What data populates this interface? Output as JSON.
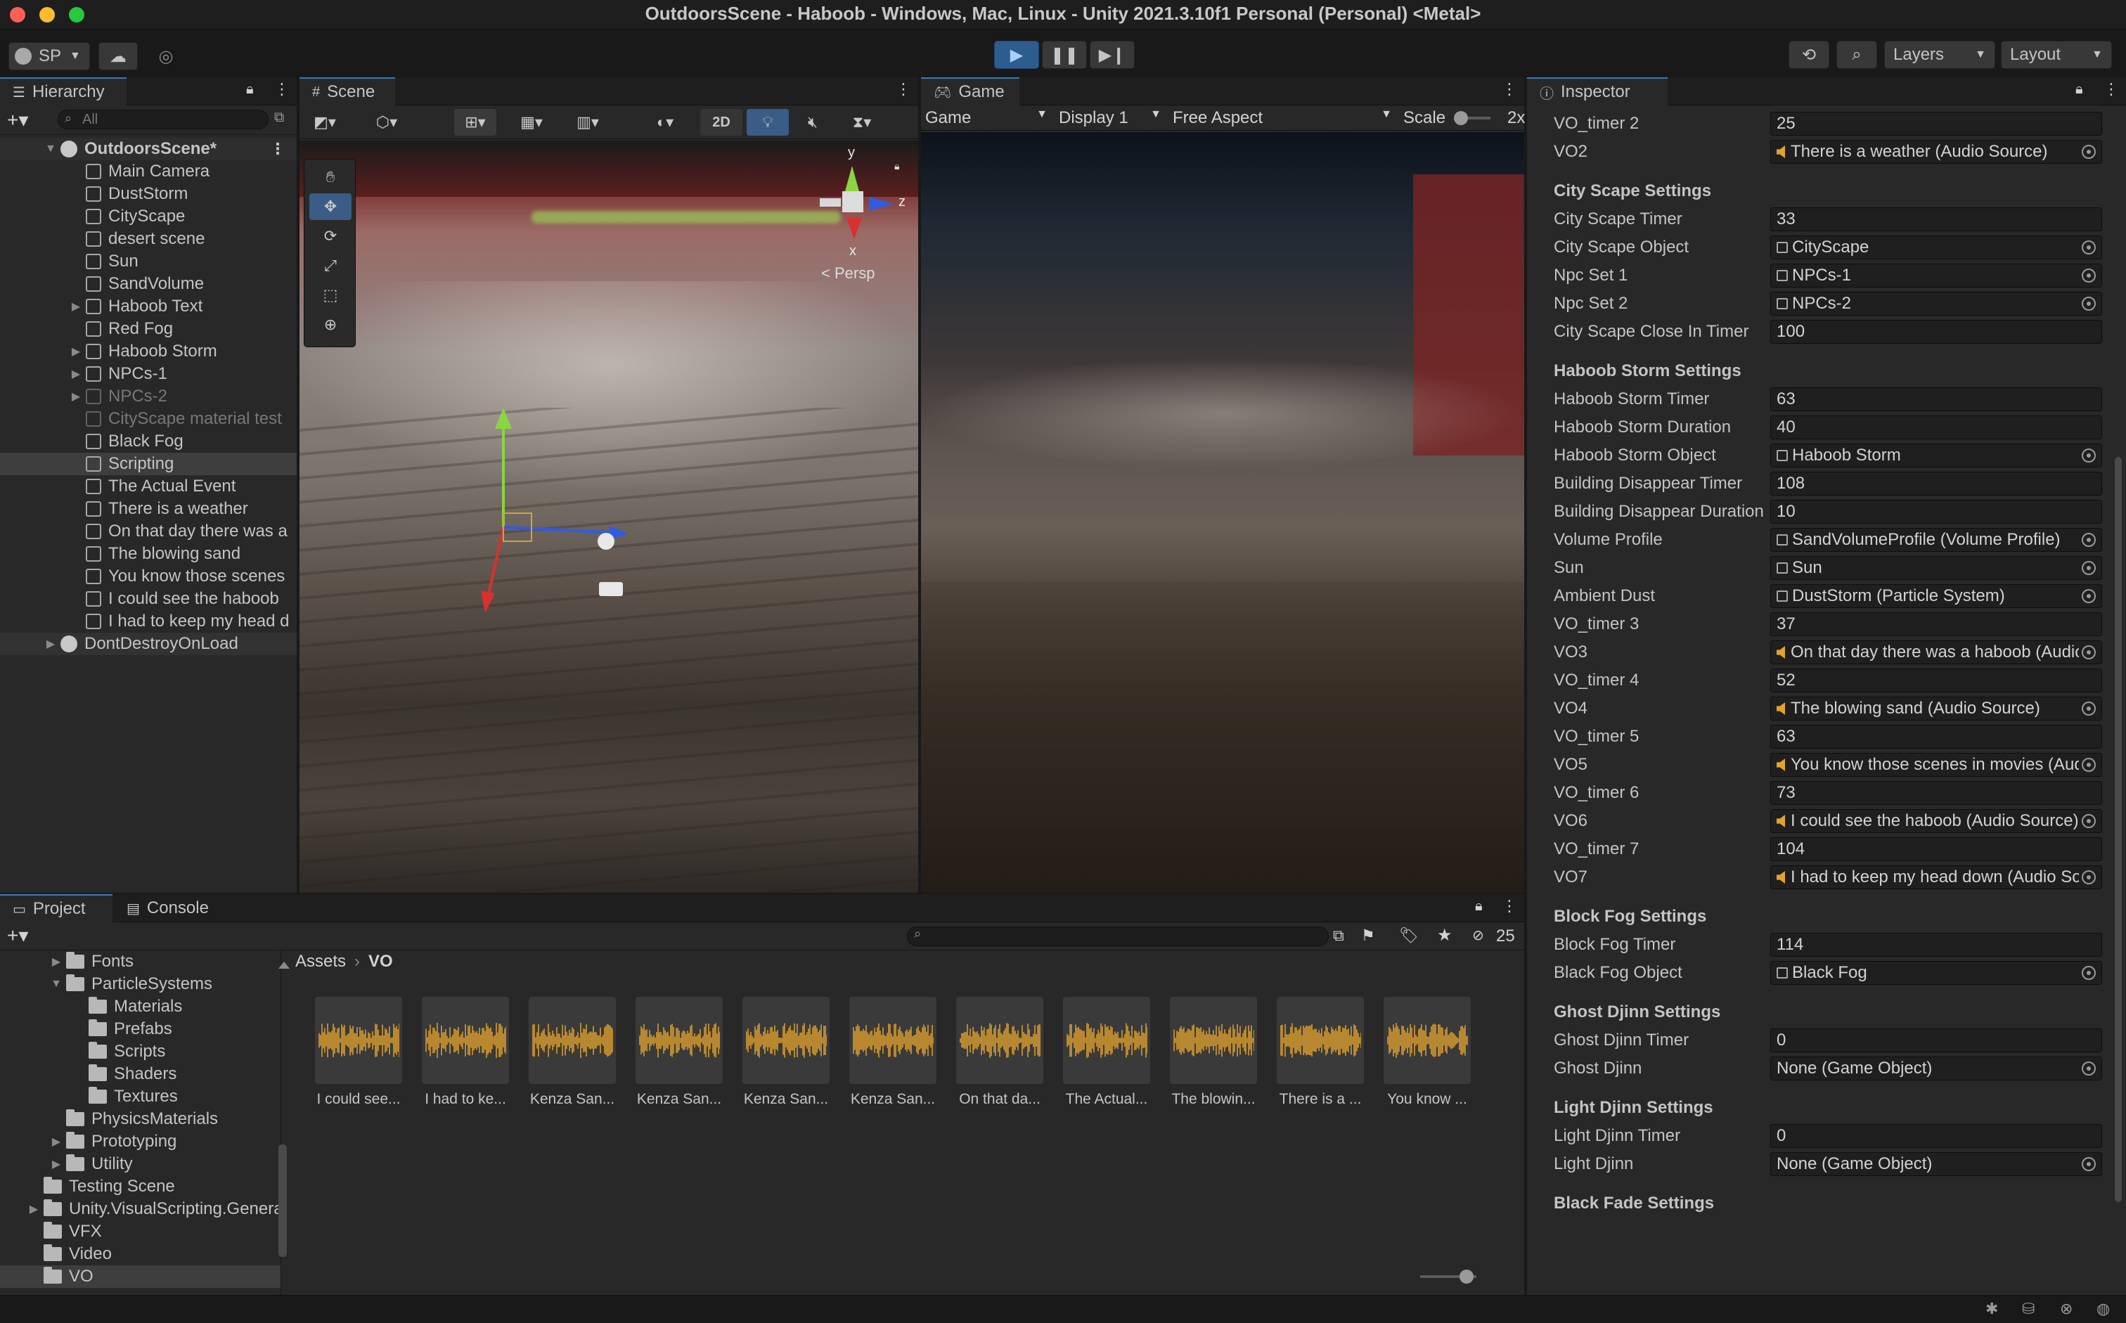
{
  "window": {
    "title": "OutdoorsScene - Haboob - Windows, Mac, Linux - Unity 2021.3.10f1 Personal (Personal) <Metal>"
  },
  "toolbar": {
    "account": "SP",
    "layers": "Layers",
    "layout": "Layout"
  },
  "hierarchy": {
    "tab": "Hierarchy",
    "search_placeholder": "All",
    "scene_name": "OutdoorsScene*",
    "items": [
      {
        "label": "Main Camera",
        "expandable": false
      },
      {
        "label": "DustStorm",
        "expandable": false
      },
      {
        "label": "CityScape",
        "expandable": false
      },
      {
        "label": "desert scene",
        "expandable": false
      },
      {
        "label": "Sun",
        "expandable": false
      },
      {
        "label": "SandVolume",
        "expandable": false
      },
      {
        "label": "Haboob Text",
        "expandable": true
      },
      {
        "label": "Red Fog",
        "expandable": false
      },
      {
        "label": "Haboob Storm",
        "expandable": true
      },
      {
        "label": "NPCs-1",
        "expandable": true
      },
      {
        "label": "NPCs-2",
        "expandable": true,
        "disabled": true
      },
      {
        "label": "CityScape material test",
        "expandable": false,
        "disabled": true
      },
      {
        "label": "Black Fog",
        "expandable": false
      },
      {
        "label": "Scripting",
        "expandable": false,
        "selected": true
      },
      {
        "label": "The Actual Event",
        "expandable": false
      },
      {
        "label": "There is a weather",
        "expandable": false
      },
      {
        "label": "On that day there was a",
        "expandable": false
      },
      {
        "label": "The blowing sand",
        "expandable": false
      },
      {
        "label": "You know those scenes",
        "expandable": false
      },
      {
        "label": "I could see the haboob",
        "expandable": false
      },
      {
        "label": "I had to keep my head d",
        "expandable": false
      }
    ],
    "dont_destroy": "DontDestroyOnLoad"
  },
  "scene": {
    "tab": "Scene",
    "mode_2d": "2D",
    "persp": "< Persp",
    "axis_y": "y",
    "axis_z": "z",
    "axis_x": "x"
  },
  "game": {
    "tab": "Game",
    "view": "Game",
    "display": "Display 1",
    "aspect": "Free Aspect",
    "scale_label": "Scale",
    "scale_value": "2x"
  },
  "inspector": {
    "tab": "Inspector",
    "rows": [
      {
        "type": "field",
        "label": "VO_timer 2",
        "value": "25"
      },
      {
        "type": "ref",
        "label": "VO2",
        "value": "There is a weather (Audio Source)",
        "icon": "speaker"
      },
      {
        "type": "header",
        "label": "City Scape Settings"
      },
      {
        "type": "field",
        "label": "City Scape Timer",
        "value": "33"
      },
      {
        "type": "ref",
        "label": "City Scape Object",
        "value": "CityScape",
        "icon": "object"
      },
      {
        "type": "ref",
        "label": "Npc Set 1",
        "value": "NPCs-1",
        "icon": "object"
      },
      {
        "type": "ref",
        "label": "Npc Set 2",
        "value": "NPCs-2",
        "icon": "object"
      },
      {
        "type": "field",
        "label": "City Scape Close In Timer",
        "value": "100"
      },
      {
        "type": "header",
        "label": "Haboob Storm Settings"
      },
      {
        "type": "field",
        "label": "Haboob Storm Timer",
        "value": "63"
      },
      {
        "type": "field",
        "label": "Haboob Storm Duration",
        "value": "40"
      },
      {
        "type": "ref",
        "label": "Haboob Storm Object",
        "value": "Haboob Storm",
        "icon": "object"
      },
      {
        "type": "field",
        "label": "Building Disappear Timer",
        "value": "108"
      },
      {
        "type": "field",
        "label": "Building Disappear Duration",
        "value": "10"
      },
      {
        "type": "ref",
        "label": "Volume Profile",
        "value": "SandVolumeProfile (Volume Profile)",
        "icon": "object"
      },
      {
        "type": "ref",
        "label": "Sun",
        "value": "Sun",
        "icon": "object"
      },
      {
        "type": "ref",
        "label": "Ambient Dust",
        "value": "DustStorm (Particle System)",
        "icon": "object"
      },
      {
        "type": "field",
        "label": "VO_timer 3",
        "value": "37"
      },
      {
        "type": "ref",
        "label": "VO3",
        "value": "On that day there was a haboob (Audio Source)",
        "icon": "speaker"
      },
      {
        "type": "field",
        "label": "VO_timer 4",
        "value": "52"
      },
      {
        "type": "ref",
        "label": "VO4",
        "value": "The blowing sand (Audio Source)",
        "icon": "speaker"
      },
      {
        "type": "field",
        "label": "VO_timer 5",
        "value": "63"
      },
      {
        "type": "ref",
        "label": "VO5",
        "value": "You know those scenes in movies (Audio Source)",
        "icon": "speaker"
      },
      {
        "type": "field",
        "label": "VO_timer 6",
        "value": "73"
      },
      {
        "type": "ref",
        "label": "VO6",
        "value": "I could see the haboob (Audio Source)",
        "icon": "speaker"
      },
      {
        "type": "field",
        "label": "VO_timer 7",
        "value": "104"
      },
      {
        "type": "ref",
        "label": "VO7",
        "value": "I had to keep my head down (Audio Source)",
        "icon": "speaker"
      },
      {
        "type": "header",
        "label": "Block Fog Settings"
      },
      {
        "type": "field",
        "label": "Block Fog Timer",
        "value": "114"
      },
      {
        "type": "ref",
        "label": "Black Fog Object",
        "value": "Black Fog",
        "icon": "object"
      },
      {
        "type": "header",
        "label": "Ghost Djinn Settings"
      },
      {
        "type": "field",
        "label": "Ghost Djinn Timer",
        "value": "0"
      },
      {
        "type": "ref",
        "label": "Ghost Djinn",
        "value": "None (Game Object)",
        "icon": "none"
      },
      {
        "type": "header",
        "label": "Light Djinn Settings"
      },
      {
        "type": "field",
        "label": "Light Djinn Timer",
        "value": "0"
      },
      {
        "type": "ref",
        "label": "Light Djinn",
        "value": "None (Game Object)",
        "icon": "none"
      },
      {
        "type": "header",
        "label": "Black Fade Settings"
      }
    ]
  },
  "project": {
    "tab_project": "Project",
    "tab_console": "Console",
    "hidden_count": "25",
    "breadcrumb_root": "Assets",
    "breadcrumb_current": "VO",
    "tree": [
      {
        "label": "Fonts",
        "indent": 1,
        "arrow": "▶"
      },
      {
        "label": "ParticleSystems",
        "indent": 1,
        "arrow": "▼"
      },
      {
        "label": "Materials",
        "indent": 2,
        "arrow": ""
      },
      {
        "label": "Prefabs",
        "indent": 2,
        "arrow": ""
      },
      {
        "label": "Scripts",
        "indent": 2,
        "arrow": ""
      },
      {
        "label": "Shaders",
        "indent": 2,
        "arrow": ""
      },
      {
        "label": "Textures",
        "indent": 2,
        "arrow": ""
      },
      {
        "label": "PhysicsMaterials",
        "indent": 1,
        "arrow": ""
      },
      {
        "label": "Prototyping",
        "indent": 1,
        "arrow": "▶"
      },
      {
        "label": "Utility",
        "indent": 1,
        "arrow": "▶"
      },
      {
        "label": "Testing Scene",
        "indent": 0,
        "arrow": ""
      },
      {
        "label": "Unity.VisualScripting.Generated",
        "indent": 0,
        "arrow": "▶"
      },
      {
        "label": "VFX",
        "indent": 0,
        "arrow": ""
      },
      {
        "label": "Video",
        "indent": 0,
        "arrow": ""
      },
      {
        "label": "VO",
        "indent": 0,
        "arrow": "",
        "selected": true
      }
    ],
    "assets": [
      "I could see...",
      "I had to ke...",
      "Kenza San...",
      "Kenza San...",
      "Kenza San...",
      "Kenza San...",
      "On that da...",
      "The Actual...",
      "The blowin...",
      "There is a ...",
      "You know ..."
    ]
  },
  "colors": {
    "accent": "#3a79bb",
    "audio": "#e2a32c",
    "gizmo_y": "#8bd444",
    "gizmo_z": "#2f5ce0",
    "gizmo_x": "#d7322f"
  }
}
